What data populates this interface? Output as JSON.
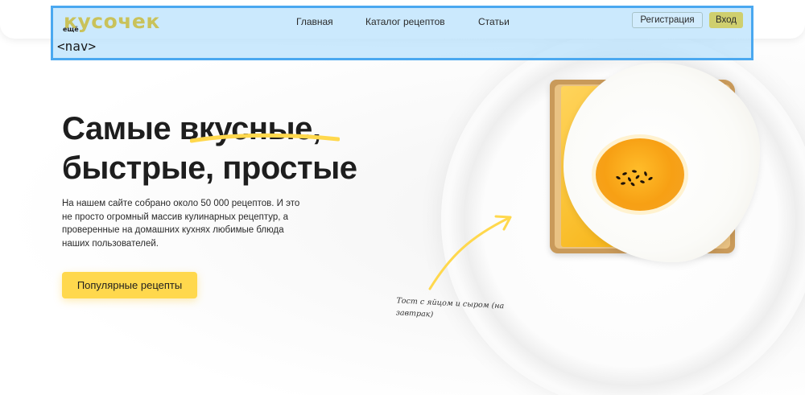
{
  "header": {
    "logo_text": "кусочек",
    "logo_small": "ещё",
    "nav_tag": "<nav>",
    "nav_links": [
      {
        "label": "Главная"
      },
      {
        "label": "Каталог рецептов"
      },
      {
        "label": "Статьи"
      }
    ],
    "register_label": "Регистрация",
    "login_label": "Вход"
  },
  "hero": {
    "title_part1": "Самые ",
    "title_accent": "вкусные",
    "title_part2": ",",
    "title_line2": "быстрые, простые",
    "description": "На нашем сайте собрано около 50 000 рецептов. И это не просто огромный массив кулинарных рецептур, а проверенные на домашних кухнях любимые блюда наших пользователей.",
    "button_label": "Популярные рецепты",
    "caption": "Тост с яйцом и сыром (на завтрак)"
  },
  "colors": {
    "accent_yellow": "#ffd84d",
    "logo_color": "#c9c25a",
    "nav_overlay": "#b7e1fc",
    "nav_overlay_border": "#4aa8f0"
  }
}
